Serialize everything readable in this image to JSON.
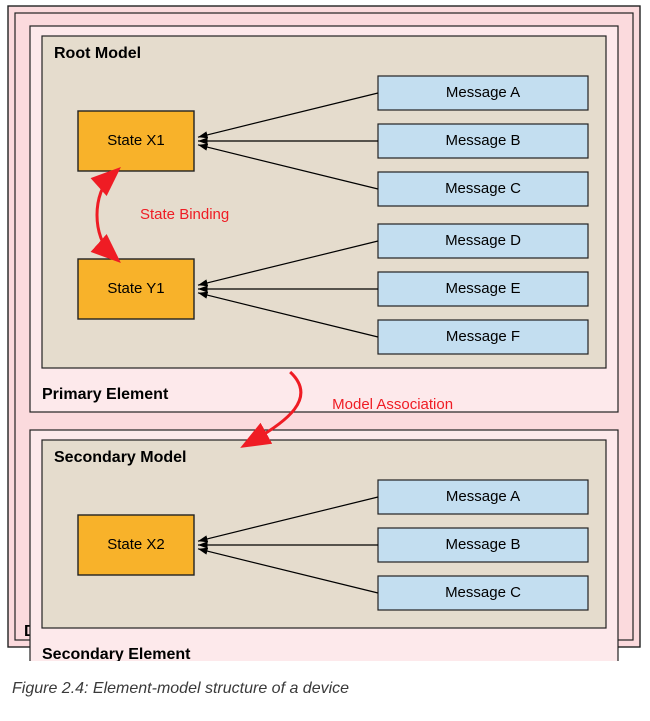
{
  "caption": "Figure 2.4: Element-model structure of a device",
  "device": {
    "label": "Device A"
  },
  "elements": [
    {
      "name": "Primary Element",
      "model": {
        "name": "Root Model",
        "states": [
          {
            "name": "State X1",
            "messages": [
              "Message A",
              "Message B",
              "Message C"
            ]
          },
          {
            "name": "State Y1",
            "messages": [
              "Message D",
              "Message E",
              "Message F"
            ]
          }
        ]
      }
    },
    {
      "name": "Secondary Element",
      "model": {
        "name": "Secondary Model",
        "states": [
          {
            "name": "State X2",
            "messages": [
              "Message A",
              "Message B",
              "Message C"
            ]
          }
        ]
      }
    }
  ],
  "annotations": {
    "state_binding": "State Binding",
    "model_association": "Model Association"
  },
  "colors": {
    "device_bg": "#fbdadd",
    "element_bg": "#fde9eb",
    "model_bg": "#e5dccd",
    "state_fill": "#f8b22a",
    "message_fill": "#c3def0",
    "border": "#222222",
    "accent": "#ef1c24"
  }
}
